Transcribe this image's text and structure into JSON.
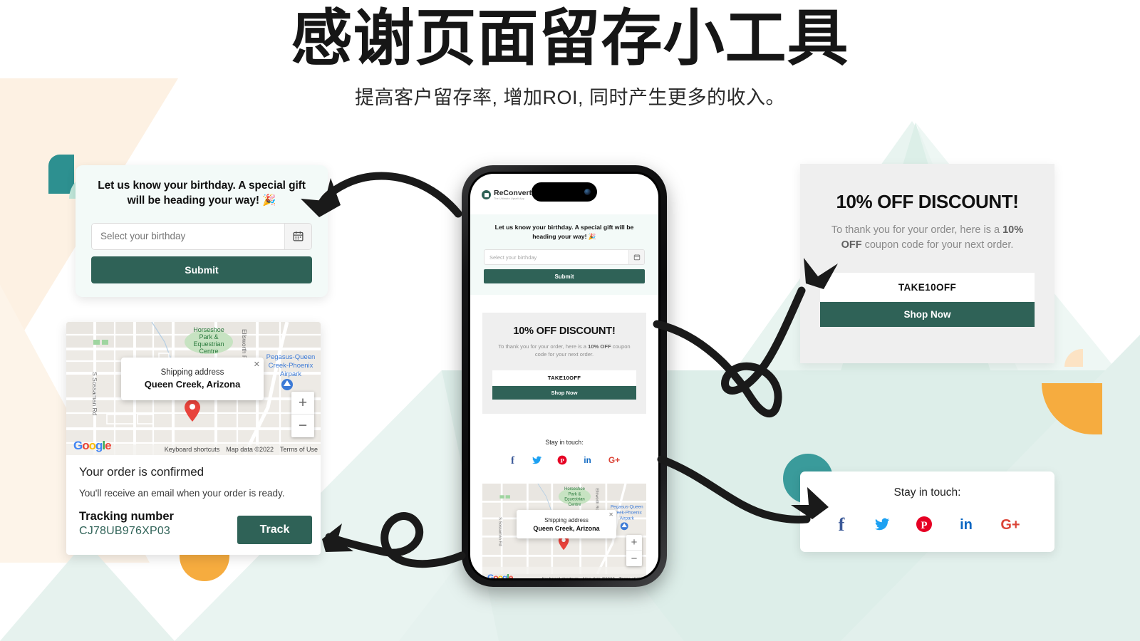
{
  "header": {
    "title": "感谢页面留存小工具",
    "subtitle": "提高客户留存率, 增加ROI, 同时产生更多的收入。"
  },
  "birthday_card": {
    "message": "Let us know your birthday. A special gift will be heading your way! 🎉",
    "input_placeholder": "Select your birthday",
    "calendar_icon": "calendar-icon",
    "submit_label": "Submit"
  },
  "discount_card": {
    "title": "10% OFF DISCOUNT!",
    "body_prefix": "To thank you for your order, here is a ",
    "body_bold1": "10% OFF",
    "body_suffix": " coupon code for your next order.",
    "coupon_code": "TAKE10OFF",
    "shop_now_label": "Shop Now"
  },
  "order_card": {
    "map": {
      "bubble_label": "Shipping address",
      "bubble_value": "Queen Creek, Arizona",
      "close_icon": "close-icon",
      "zoom_in": "+",
      "zoom_out": "−",
      "labels": {
        "park": "Horseshoe Park & Equestrian Centre",
        "road_left": "S Sossaman Rd",
        "road_right": "Ellsworth Rd",
        "airpark": "Pegasus-Queen Creek-Phoenix Airpark"
      },
      "google_logo": [
        "G",
        "o",
        "o",
        "g",
        "l",
        "e"
      ],
      "footer": [
        "Keyboard shortcuts",
        "Map data ©2022",
        "Terms of Use"
      ]
    },
    "heading": "Your order is confirmed",
    "subtext": "You'll receive an email when your order is ready.",
    "tracking_label": "Tracking number",
    "tracking_number": "CJ78UB976XP03",
    "track_button": "Track"
  },
  "social_card": {
    "title": "Stay in touch:",
    "icons": [
      {
        "name": "facebook-icon",
        "label": "f",
        "color": "#3b5998"
      },
      {
        "name": "twitter-icon",
        "label": "t",
        "color": "#1da1f2"
      },
      {
        "name": "pinterest-icon",
        "label": "p",
        "color": "#e60023"
      },
      {
        "name": "linkedin-icon",
        "label": "in",
        "color": "#0a66c2"
      },
      {
        "name": "googleplus-icon",
        "label": "G+",
        "color": "#db4437"
      }
    ]
  },
  "phone": {
    "brand": "ReConvert",
    "tagline": "The Ultimate Upsell App",
    "birthday_message": "Let us know your birthday. A special gift will be heading your way! 🎉",
    "input_placeholder": "Select your birthday",
    "submit_label": "Submit",
    "discount_title": "10% OFF DISCOUNT!",
    "discount_body_prefix": "To thank you for your order, here is a ",
    "discount_body_bold": "10% OFF",
    "discount_body_suffix": " coupon code for your next order.",
    "coupon_code": "TAKE10OFF",
    "shop_now_label": "Shop Now",
    "social_title": "Stay in touch:",
    "map_bubble_label": "Shipping address",
    "map_bubble_value": "Queen Creek, Arizona"
  },
  "colors": {
    "brand_green": "#2f6257",
    "teal": "#3a9b9b",
    "mint_light": "#b8e3d7",
    "orange": "#f6ac3f",
    "peach": "#fbe3c8",
    "bg_mint": "#dff0ea",
    "bg_cream": "#fdf2e4"
  }
}
